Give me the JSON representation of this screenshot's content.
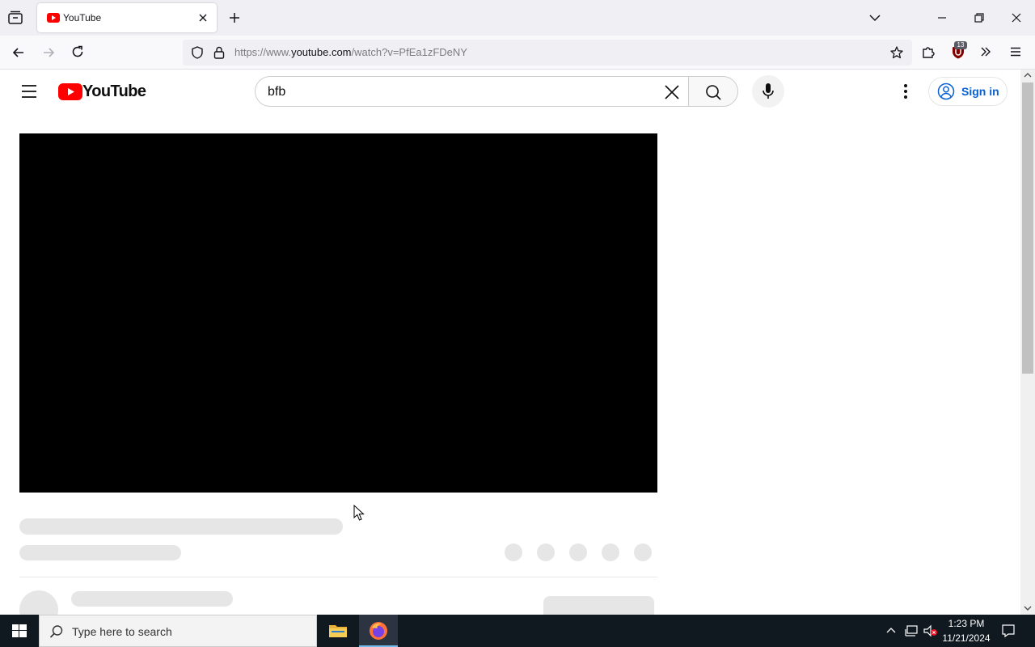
{
  "browser": {
    "tab_title": "YouTube",
    "url_prefix": "https://www.",
    "url_host": "youtube.com",
    "url_path": "/watch?v=PfEa1zFDeNY",
    "extension_badge": "13",
    "accent_color": "#e0245e"
  },
  "youtube": {
    "logo_text": "YouTube",
    "logo_red": "#ff0000",
    "search_value": "bfb",
    "sign_in_label": "Sign in",
    "link_blue": "#065fd4"
  },
  "taskbar": {
    "search_placeholder": "Type here to search",
    "time": "1:23 PM",
    "date": "11/21/2024"
  },
  "icons": [
    "tab-overview-icon",
    "youtube-favicon",
    "close-icon",
    "new-tab-icon",
    "list-all-tabs-icon",
    "minimize-icon",
    "restore-icon",
    "window-close-icon",
    "back-icon",
    "forward-icon",
    "reload-icon",
    "shield-icon",
    "lock-icon",
    "bookmark-star-icon",
    "extensions-icon",
    "ublock-icon",
    "overflow-icon",
    "menu-icon",
    "hamburger-icon",
    "youtube-logo-icon",
    "clear-search-icon",
    "search-icon",
    "mic-icon",
    "more-vert-icon",
    "account-icon",
    "windows-start-icon",
    "file-explorer-icon",
    "firefox-icon",
    "chevron-up-icon",
    "network-icon",
    "volume-muted-icon",
    "notification-icon"
  ]
}
